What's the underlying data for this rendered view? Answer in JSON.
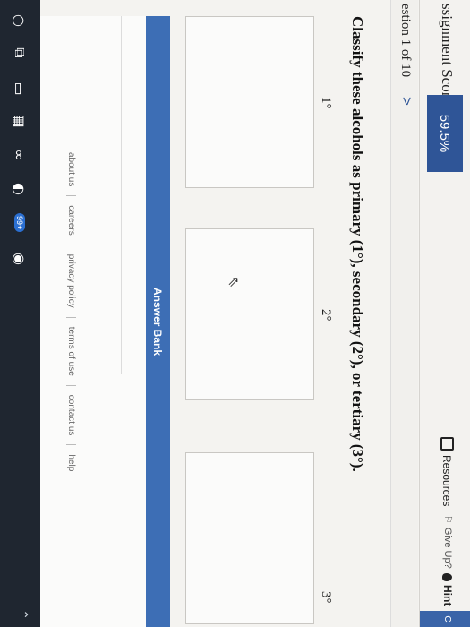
{
  "topbar": {
    "score_label": "ssignment Score:",
    "score_value": "59.5%",
    "resources_label": "Resources",
    "giveup_label": "Give Up?",
    "hint_label": "Hint",
    "corner_text": "C"
  },
  "question_nav": {
    "number": "estion 1 of 10",
    "next_glyph": ">"
  },
  "question": {
    "prompt": "Classify these alcohols as primary (1°), secondary (2°), or tertiary (3°).",
    "categories": [
      "1°",
      "2°",
      "3°"
    ]
  },
  "answer_bank": {
    "title": "Answer Bank"
  },
  "footer": {
    "links": [
      "about us",
      "careers",
      "privacy policy",
      "terms of use",
      "contact us",
      "help"
    ]
  },
  "taskbar": {
    "badge": "99+"
  },
  "colors": {
    "accent": "#2f5597",
    "answer_bank_header": "#3d6eb5",
    "taskbar": "#1f2630"
  }
}
